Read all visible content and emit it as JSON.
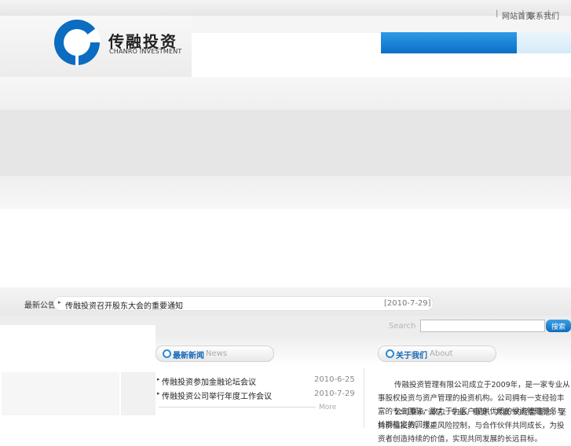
{
  "header": {
    "logo_cn": "传融投资",
    "logo_en": "CHANRO INVESTMENT",
    "top_links": [
      "网站首页",
      "联系我们"
    ],
    "colors": {
      "brand_blue": "#0b6fc6",
      "light_blue": "#d6ebf8"
    }
  },
  "notice": {
    "label": "最新公告",
    "title": "传融投资召开股东大会的重要通知",
    "date": "[2010-7-29]"
  },
  "search": {
    "label": "Search",
    "input_value": "",
    "button_label": "搜索"
  },
  "news": {
    "title_cn": "最新新闻",
    "title_en": "News",
    "items": [
      {
        "title": "传融投资参加金融论坛会议",
        "date": "2010-6-25"
      },
      {
        "title": "传融投资公司举行年度工作会议",
        "date": "2010-7-29"
      }
    ],
    "more_label": "More"
  },
  "about": {
    "title_cn": "关于我们",
    "title_en": "About",
    "paragraphs": [
      "传融投资管理有限公司成立于2009年，是一家专业从事股权投资与资产管理的投资机构。公司拥有一支经验丰富的专业团队，致力于为客户提供优质的投资管理服务与长期稳定的回报。",
      "公司秉承“诚信、专业、稳健、共赢”的经营理念，坚持价值投资，注重风险控制，与合作伙伴共同成长，为投资者创造持续的价值，实现共同发展的长远目标。"
    ]
  }
}
